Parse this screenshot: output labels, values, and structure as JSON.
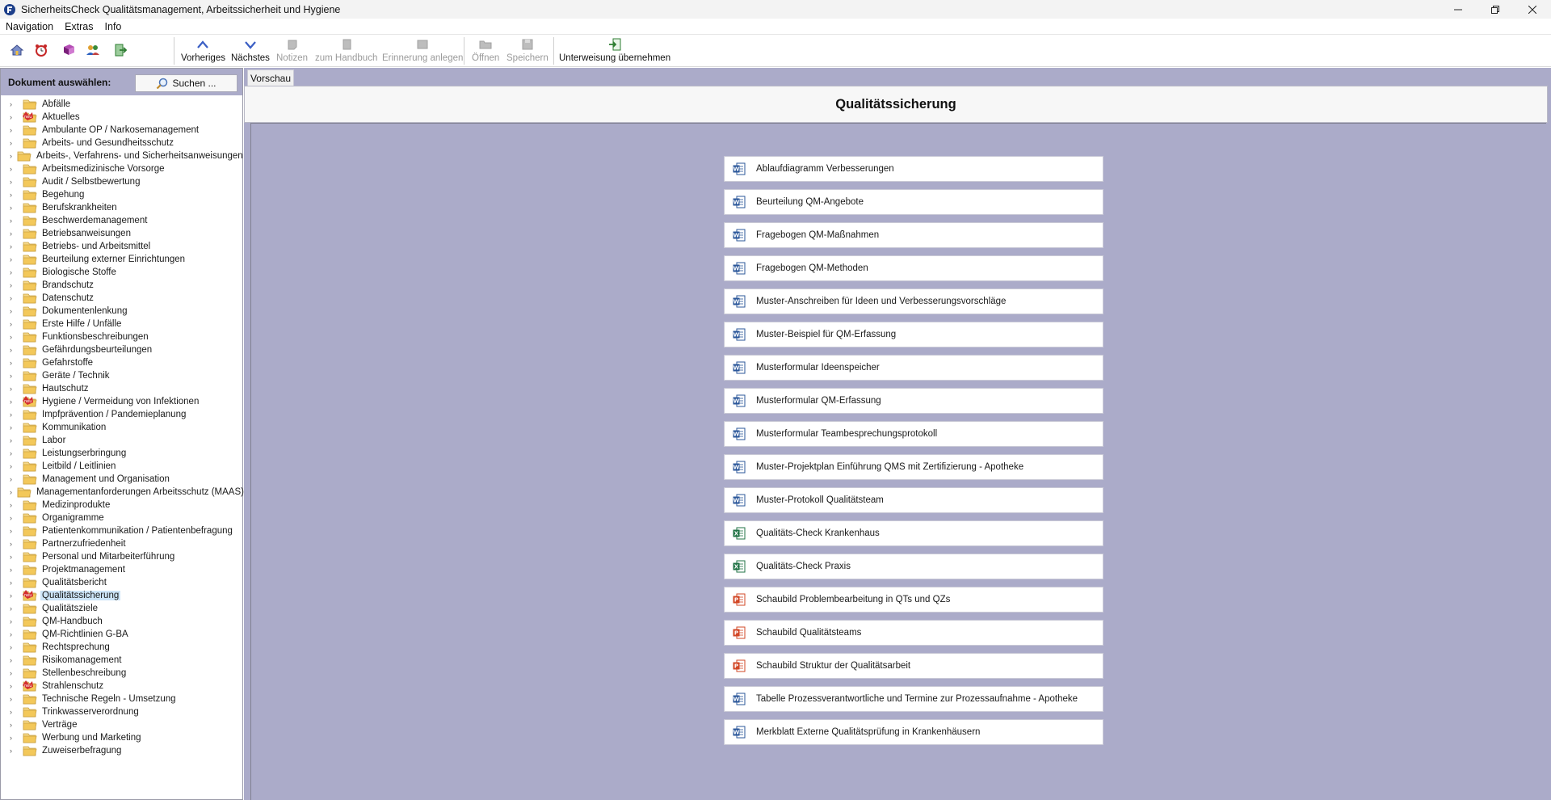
{
  "window": {
    "title": "SicherheitsCheck Qualitätsmanagement, Arbeitssicherheit und Hygiene",
    "controls": [
      "minimize-icon",
      "restore-icon",
      "close-icon"
    ]
  },
  "menubar": {
    "items": [
      {
        "label": "Navigation"
      },
      {
        "label": "Extras"
      },
      {
        "label": "Info"
      }
    ]
  },
  "toolbar": {
    "quick_icons": [
      "home-icon",
      "alarm-clock-icon",
      "book-icon",
      "users-icon",
      "exit-icon"
    ],
    "buttons": [
      {
        "label": "Vorheriges",
        "icon": "chevron-up-icon",
        "enabled": true
      },
      {
        "label": "Nächstes",
        "icon": "chevron-down-icon",
        "enabled": true
      },
      {
        "label": "Notizen",
        "icon": "note-icon",
        "enabled": false
      },
      {
        "label": "zum Handbuch",
        "icon": "handbook-icon",
        "enabled": false
      },
      {
        "label": "Erinnerung anlegen",
        "icon": "reminder-icon",
        "enabled": false
      },
      {
        "label": "Öffnen",
        "icon": "open-icon",
        "enabled": false
      },
      {
        "label": "Speichern",
        "icon": "save-icon",
        "enabled": false
      },
      {
        "label": "Unterweisung übernehmen",
        "icon": "import-icon",
        "enabled": true
      }
    ]
  },
  "sidebar": {
    "heading": "Dokument auswählen:",
    "search_label": "Suchen ...",
    "items": [
      {
        "label": "Abfälle",
        "new": false,
        "selected": false
      },
      {
        "label": "Aktuelles",
        "new": true,
        "selected": false
      },
      {
        "label": "Ambulante OP / Narkosemanagement",
        "new": false,
        "selected": false
      },
      {
        "label": "Arbeits- und Gesundheitsschutz",
        "new": false,
        "selected": false
      },
      {
        "label": "Arbeits-, Verfahrens- und Sicherheitsanweisungen",
        "new": false,
        "selected": false
      },
      {
        "label": "Arbeitsmedizinische Vorsorge",
        "new": false,
        "selected": false
      },
      {
        "label": "Audit / Selbstbewertung",
        "new": false,
        "selected": false
      },
      {
        "label": "Begehung",
        "new": false,
        "selected": false
      },
      {
        "label": "Berufskrankheiten",
        "new": false,
        "selected": false
      },
      {
        "label": "Beschwerdemanagement",
        "new": false,
        "selected": false
      },
      {
        "label": "Betriebsanweisungen",
        "new": false,
        "selected": false
      },
      {
        "label": "Betriebs- und Arbeitsmittel",
        "new": false,
        "selected": false
      },
      {
        "label": "Beurteilung externer Einrichtungen",
        "new": false,
        "selected": false
      },
      {
        "label": "Biologische Stoffe",
        "new": false,
        "selected": false
      },
      {
        "label": "Brandschutz",
        "new": false,
        "selected": false
      },
      {
        "label": "Datenschutz",
        "new": false,
        "selected": false
      },
      {
        "label": "Dokumentenlenkung",
        "new": false,
        "selected": false
      },
      {
        "label": "Erste Hilfe / Unfälle",
        "new": false,
        "selected": false
      },
      {
        "label": "Funktionsbeschreibungen",
        "new": false,
        "selected": false
      },
      {
        "label": "Gefährdungsbeurteilungen",
        "new": false,
        "selected": false
      },
      {
        "label": "Gefahrstoffe",
        "new": false,
        "selected": false
      },
      {
        "label": "Geräte / Technik",
        "new": false,
        "selected": false
      },
      {
        "label": "Hautschutz",
        "new": false,
        "selected": false
      },
      {
        "label": "Hygiene / Vermeidung von Infektionen",
        "new": true,
        "selected": false
      },
      {
        "label": "Impfprävention / Pandemieplanung",
        "new": false,
        "selected": false
      },
      {
        "label": "Kommunikation",
        "new": false,
        "selected": false
      },
      {
        "label": "Labor",
        "new": false,
        "selected": false
      },
      {
        "label": "Leistungserbringung",
        "new": false,
        "selected": false
      },
      {
        "label": "Leitbild / Leitlinien",
        "new": false,
        "selected": false
      },
      {
        "label": "Management und Organisation",
        "new": false,
        "selected": false
      },
      {
        "label": "Managementanforderungen Arbeitsschutz (MAAS)",
        "new": false,
        "selected": false
      },
      {
        "label": "Medizinprodukte",
        "new": false,
        "selected": false
      },
      {
        "label": "Organigramme",
        "new": false,
        "selected": false
      },
      {
        "label": "Patientenkommunikation / Patientenbefragung",
        "new": false,
        "selected": false
      },
      {
        "label": "Partnerzufriedenheit",
        "new": false,
        "selected": false
      },
      {
        "label": "Personal und Mitarbeiterführung",
        "new": false,
        "selected": false
      },
      {
        "label": "Projektmanagement",
        "new": false,
        "selected": false
      },
      {
        "label": "Qualitätsbericht",
        "new": false,
        "selected": false
      },
      {
        "label": "Qualitätssicherung",
        "new": true,
        "selected": true
      },
      {
        "label": "Qualitätsziele",
        "new": false,
        "selected": false
      },
      {
        "label": "QM-Handbuch",
        "new": false,
        "selected": false
      },
      {
        "label": "QM-Richtlinien G-BA",
        "new": false,
        "selected": false
      },
      {
        "label": "Rechtsprechung",
        "new": false,
        "selected": false
      },
      {
        "label": "Risikomanagement",
        "new": false,
        "selected": false
      },
      {
        "label": "Stellenbeschreibung",
        "new": false,
        "selected": false
      },
      {
        "label": "Strahlenschutz",
        "new": true,
        "selected": false
      },
      {
        "label": "Technische Regeln - Umsetzung",
        "new": false,
        "selected": false
      },
      {
        "label": "Trinkwasserverordnung",
        "new": false,
        "selected": false
      },
      {
        "label": "Verträge",
        "new": false,
        "selected": false
      },
      {
        "label": "Werbung und Marketing",
        "new": false,
        "selected": false
      },
      {
        "label": "Zuweiserbefragung",
        "new": false,
        "selected": false
      }
    ]
  },
  "main": {
    "tab_label": "Vorschau",
    "title": "Qualitätssicherung",
    "documents": [
      {
        "label": "Ablaufdiagramm Verbesserungen",
        "type": "word"
      },
      {
        "label": "Beurteilung QM-Angebote",
        "type": "word"
      },
      {
        "label": "Fragebogen QM-Maßnahmen",
        "type": "word"
      },
      {
        "label": "Fragebogen QM-Methoden",
        "type": "word"
      },
      {
        "label": "Muster-Anschreiben für Ideen und Verbesserungsvorschläge",
        "type": "word"
      },
      {
        "label": "Muster-Beispiel für QM-Erfassung",
        "type": "word"
      },
      {
        "label": "Musterformular Ideenspeicher",
        "type": "word"
      },
      {
        "label": "Musterformular QM-Erfassung",
        "type": "word"
      },
      {
        "label": "Musterformular Teambesprechungsprotokoll",
        "type": "word"
      },
      {
        "label": "Muster-Projektplan Einführung QMS mit Zertifizierung - Apotheke",
        "type": "word"
      },
      {
        "label": "Muster-Protokoll Qualitätsteam",
        "type": "word"
      },
      {
        "label": "Qualitäts-Check Krankenhaus",
        "type": "excel"
      },
      {
        "label": "Qualitäts-Check Praxis",
        "type": "excel"
      },
      {
        "label": "Schaubild Problembearbeitung in QTs und QZs",
        "type": "powerpoint"
      },
      {
        "label": "Schaubild Qualitätsteams",
        "type": "powerpoint"
      },
      {
        "label": "Schaubild Struktur der Qualitätsarbeit",
        "type": "powerpoint"
      },
      {
        "label": "Tabelle Prozessverantwortliche und Termine zur Prozessaufnahme - Apotheke",
        "type": "word"
      },
      {
        "label": "Merkblatt Externe Qualitätsprüfung in Krankenhäusern",
        "type": "word"
      }
    ]
  },
  "colors": {
    "panel_bg": "#ababc9",
    "selection": "#cce4f7",
    "word": "#2b579a",
    "excel": "#217346",
    "powerpoint": "#d24726",
    "folder": "#f3d27a"
  }
}
